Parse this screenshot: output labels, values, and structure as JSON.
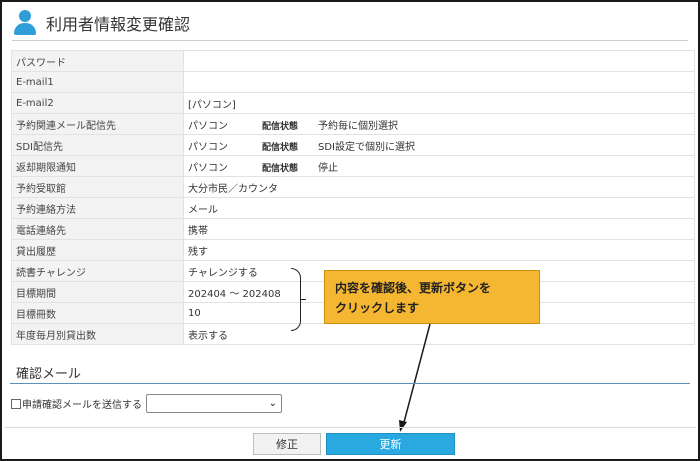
{
  "page": {
    "title": "利用者情報変更確認",
    "icon": "user-icon"
  },
  "rows": [
    {
      "label": "パスワード",
      "value": ""
    },
    {
      "label": "E-mail1",
      "value": ""
    },
    {
      "label": "E-mail2",
      "value": "[パソコン]"
    },
    {
      "label": "予約関連メール配信先",
      "value": "パソコン",
      "status_label": "配信状態",
      "status_value": "予約毎に個別選択"
    },
    {
      "label": "SDI配信先",
      "value": "パソコン",
      "status_label": "配信状態",
      "status_value": "SDI設定で個別に選択"
    },
    {
      "label": "返却期限通知",
      "value": "パソコン",
      "status_label": "配信状態",
      "status_value": "停止"
    },
    {
      "label": "予約受取館",
      "value": "大分市民／カウンタ"
    },
    {
      "label": "予約連絡方法",
      "value": "メール"
    },
    {
      "label": "電話連絡先",
      "value": "携帯"
    },
    {
      "label": "貸出履歴",
      "value": "残す"
    },
    {
      "label": "読書チャレンジ",
      "value": "チャレンジする"
    },
    {
      "label": "目標期間",
      "value": "202404 ～ 202408"
    },
    {
      "label": "目標冊数",
      "value": "10"
    },
    {
      "label": "年度毎月別貸出数",
      "value": "表示する"
    }
  ],
  "callout": {
    "line1": "内容を確認後、更新ボタンを",
    "line2": "クリックします"
  },
  "confirm_mail": {
    "section_title": "確認メール",
    "checkbox_label": "申請確認メールを送信する",
    "select_value": ""
  },
  "buttons": {
    "modify": "修正",
    "update": "更新"
  },
  "colors": {
    "accent": "#2aa9e0",
    "callout": "#f5b731",
    "section_line": "#5a8fc0"
  }
}
